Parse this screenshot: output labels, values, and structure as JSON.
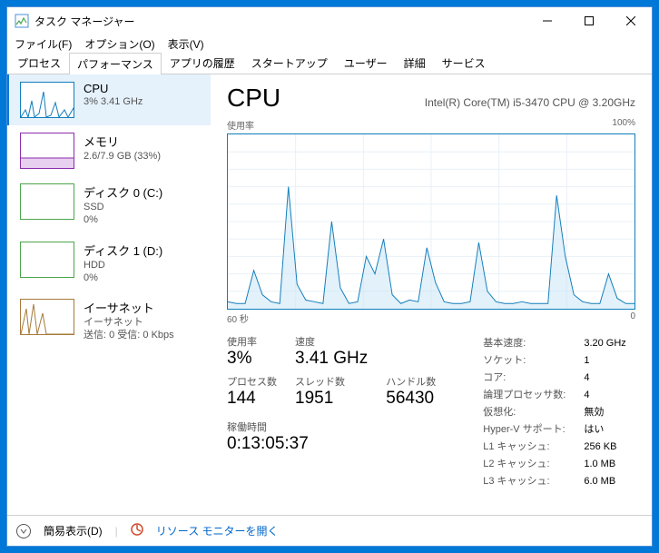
{
  "window": {
    "title": "タスク マネージャー"
  },
  "menu": {
    "file": "ファイル(F)",
    "options": "オプション(O)",
    "view": "表示(V)"
  },
  "tabs": [
    "プロセス",
    "パフォーマンス",
    "アプリの履歴",
    "スタートアップ",
    "ユーザー",
    "詳細",
    "サービス"
  ],
  "active_tab": 1,
  "sidebar": [
    {
      "title": "CPU",
      "sub": "3%  3.41 GHz",
      "kind": "cpu"
    },
    {
      "title": "メモリ",
      "sub": "2.6/7.9 GB (33%)",
      "kind": "mem"
    },
    {
      "title": "ディスク 0 (C:)",
      "sub": "SSD\n0%",
      "kind": "disk"
    },
    {
      "title": "ディスク 1 (D:)",
      "sub": "HDD\n0%",
      "kind": "disk"
    },
    {
      "title": "イーサネット",
      "sub": "イーサネット\n送信: 0 受信: 0 Kbps",
      "kind": "eth"
    }
  ],
  "main": {
    "heading": "CPU",
    "subtitle": "Intel(R) Core(TM) i5-3470 CPU @ 3.20GHz",
    "graph_top_left": "使用率",
    "graph_top_right": "100%",
    "graph_bottom_left": "60 秒",
    "graph_bottom_right": "0",
    "left_labels": {
      "util": "使用率",
      "speed": "速度",
      "procs": "プロセス数",
      "threads": "スレッド数",
      "handles": "ハンドル数"
    },
    "left_values": {
      "util": "3%",
      "speed": "3.41 GHz",
      "procs": "144",
      "threads": "1951",
      "handles": "56430"
    },
    "uptime_label": "稼働時間",
    "uptime_value": "0:13:05:37",
    "right_rows": [
      [
        "基本速度:",
        "3.20 GHz"
      ],
      [
        "ソケット:",
        "1"
      ],
      [
        "コア:",
        "4"
      ],
      [
        "論理プロセッサ数:",
        "4"
      ],
      [
        "仮想化:",
        "無効"
      ],
      [
        "Hyper-V サポート:",
        "はい"
      ],
      [
        "L1 キャッシュ:",
        "256 KB"
      ],
      [
        "L2 キャッシュ:",
        "1.0 MB"
      ],
      [
        "L3 キャッシュ:",
        "6.0 MB"
      ]
    ]
  },
  "footer": {
    "fewer": "簡易表示(D)",
    "resmon": "リソース モニターを開く"
  },
  "chart_data": {
    "type": "line",
    "title": "CPU 使用率",
    "xlabel": "60 秒",
    "ylabel": "使用率",
    "ylim": [
      0,
      100
    ],
    "x_range_seconds": 60,
    "values_pct": [
      4,
      3,
      3,
      22,
      8,
      4,
      3,
      70,
      14,
      5,
      4,
      3,
      50,
      12,
      3,
      4,
      30,
      20,
      40,
      8,
      3,
      5,
      4,
      35,
      15,
      4,
      3,
      3,
      4,
      38,
      10,
      4,
      3,
      3,
      4,
      3,
      3,
      3,
      65,
      30,
      8,
      4,
      3,
      3,
      20,
      6,
      3,
      3
    ]
  }
}
